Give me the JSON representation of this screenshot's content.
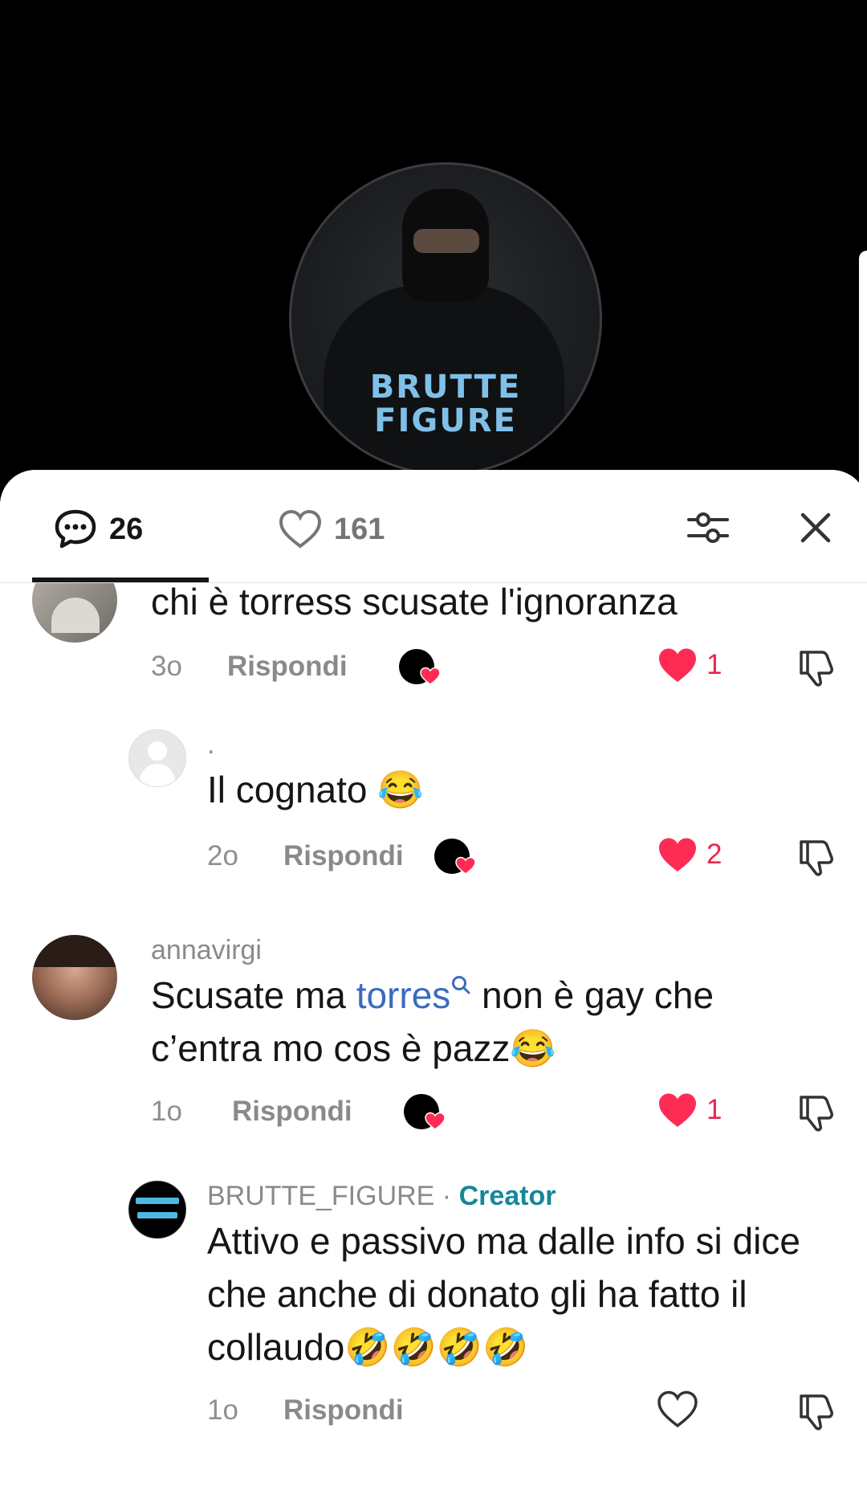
{
  "video": {
    "brand_line1": "BRUTTE",
    "brand_line2": "FIGURE"
  },
  "header": {
    "comments_count": "26",
    "likes_count": "161",
    "filter_icon": "sliders-icon",
    "close_icon": "close-icon"
  },
  "comments": [
    {
      "username": "",
      "text": "chi è torress scusate l'ignoranza",
      "age": "3o",
      "reply_label": "Rispondi",
      "likes": "1",
      "liked": true,
      "creator_liked": true
    },
    {
      "username": ".",
      "text": "Il cognato 😂",
      "age": "2o",
      "reply_label": "Rispondi",
      "likes": "2",
      "liked": true,
      "creator_liked": true
    },
    {
      "username": "annavirgi",
      "text_before": "Scusate ma ",
      "mention": "torres",
      "text_after": " non è gay che c’entra mo cos è pazz😂",
      "age": "1o",
      "reply_label": "Rispondi",
      "likes": "1",
      "liked": true,
      "creator_liked": true
    },
    {
      "username": "BRUTTE_FIGURE",
      "separator": " · ",
      "badge": "Creator",
      "text": "Attivo e passivo ma dalle info si dice che anche di donato gli ha fatto il collaudo🤣🤣🤣🤣",
      "age": "1o",
      "reply_label": "Rispondi",
      "likes": "",
      "liked": false,
      "creator_liked": false
    }
  ],
  "colors": {
    "like_red": "#FE2C55",
    "mention_blue": "#3A6BBF",
    "creator_teal": "#16869A"
  }
}
